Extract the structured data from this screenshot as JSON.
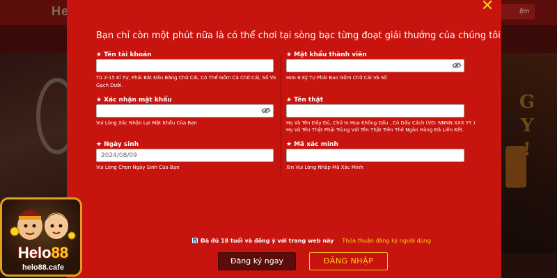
{
  "background": {
    "logo_text": "He",
    "top_button_label": "ệm",
    "right_letters": "G\nY\n!"
  },
  "modal": {
    "title": "Bạn chỉ còn một phút nữa là có thể chơi tại sòng bạc từng đoạt giải thưởng của chúng tôi",
    "close_icon": "close-icon",
    "colors": {
      "background": "#c8140e",
      "accent": "#ffd21a",
      "primary_button": "#5b0d0b"
    },
    "fields": {
      "username": {
        "label": "Tên tài khoản",
        "value": "",
        "hint": "Từ 2-15 Kí Tự, Phải Bắt Đầu Bằng Chữ Cái, Có Thể Gồm Cả Chữ Cái, Số Và Gạch Dưới."
      },
      "password": {
        "label": "Mật khẩu thành viên",
        "value": "",
        "hint": "Hơn 6 Ký Tự Phải Bao Gồm Chữ Cái Và Số"
      },
      "confirm_password": {
        "label": "Xác nhận mật khẩu",
        "value": "",
        "hint": "Vui Lòng Xác Nhận Lại Mật Khẩu Của Bạn"
      },
      "real_name": {
        "label": "Tên thật",
        "value": "",
        "hint_line1": "Họ Và Tên Đầy Đủ, Chữ In Hoa Không Dấu , Có Dấu Cách (VD: NNNN XXX YY ).",
        "hint_line2": "Họ Và Tên Thật Phải Trùng Với Tên Thật Trên Thẻ Ngân Hàng Đã Liên Kết."
      },
      "birthday": {
        "label": "Ngày sinh",
        "value": "2024/08/09",
        "hint": "Vui Lòng Chọn Ngày Sinh Của Bạn"
      },
      "captcha": {
        "label": "Mã xác minh",
        "value": "",
        "hint": "Xin Vui Lòng Nhập Mã Xác Minh"
      }
    },
    "agree": {
      "checked": true,
      "text": "Đã đủ 18 tuổi và đồng ý với trang web này",
      "link": "Thỏa thuận đăng ký người dùng"
    },
    "buttons": {
      "register": "Đăng ký ngay",
      "login": "ĐĂNG NHẬP"
    }
  },
  "logo": {
    "brand_prefix": "Helo",
    "brand_number": "88",
    "domain": "helo88.cafe"
  }
}
